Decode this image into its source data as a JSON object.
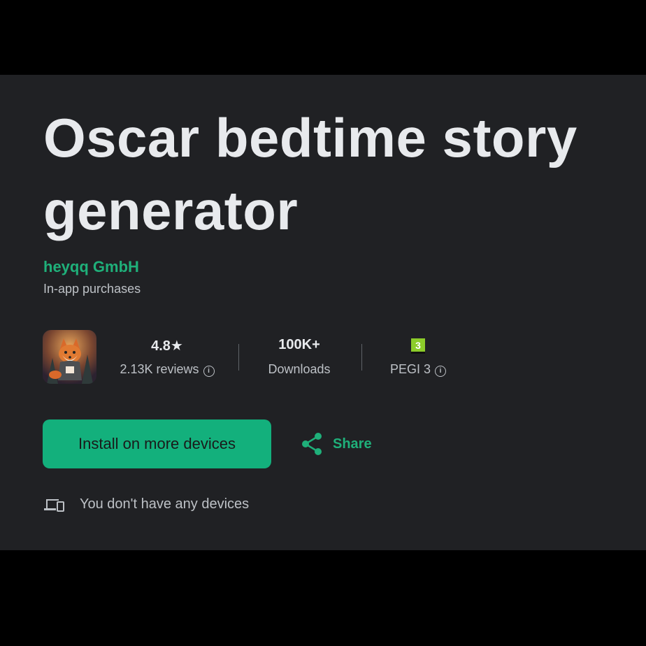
{
  "app": {
    "title": "Oscar bedtime story generator",
    "developer": "heyqq GmbH",
    "in_app_purchases": "In-app purchases"
  },
  "stats": {
    "rating_value": "4.8★",
    "reviews_label": "2.13K reviews",
    "downloads_value": "100K+",
    "downloads_label": "Downloads",
    "pegi_badge": "3",
    "pegi_label": "PEGI 3"
  },
  "actions": {
    "install_label": "Install on more devices",
    "share_label": "Share"
  },
  "devices": {
    "message": "You don't have any devices"
  },
  "colors": {
    "accent": "#13b07c",
    "panel_background": "#202124",
    "pegi_green": "#8ccc2a"
  },
  "icons": [
    "info-icon",
    "share-icon",
    "devices-icon",
    "app-icon"
  ]
}
